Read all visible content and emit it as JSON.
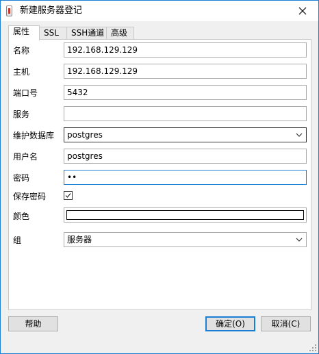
{
  "window": {
    "title": "新建服务器登记",
    "close_glyph": "close-icon"
  },
  "tabs": [
    {
      "label": "属性",
      "active": true
    },
    {
      "label": "SSL",
      "active": false
    },
    {
      "label": "SSH通道",
      "active": false
    },
    {
      "label": "高级",
      "active": false
    }
  ],
  "form": {
    "name": {
      "label": "名称",
      "value": "192.168.129.129"
    },
    "host": {
      "label": "主机",
      "value": "192.168.129.129"
    },
    "port": {
      "label": "端口号",
      "value": "5432"
    },
    "service": {
      "label": "服务",
      "value": ""
    },
    "maintenance_db": {
      "label": "维护数据库",
      "value": "postgres"
    },
    "username": {
      "label": "用户名",
      "value": "postgres"
    },
    "password": {
      "label": "密码",
      "value": "••"
    },
    "save_password": {
      "label": "保存密码",
      "checked": true
    },
    "color": {
      "label": "颜色",
      "value": "#ffffff"
    },
    "group": {
      "label": "组",
      "value": "服务器"
    }
  },
  "buttons": {
    "help": "帮助",
    "ok": "确定(O)",
    "cancel": "取消(C)"
  },
  "colors": {
    "accent": "#1a7fd4",
    "window_bg": "#f0f0f0",
    "panel_bg": "#ffffff"
  }
}
